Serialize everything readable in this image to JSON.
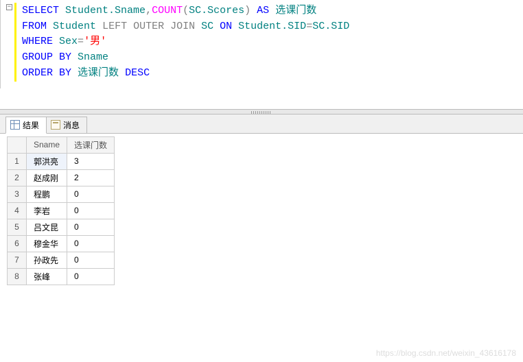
{
  "editor": {
    "collapse_symbol": "−",
    "line1": {
      "select": "SELECT",
      "col1": "Student.Sname",
      "comma": ",",
      "func": "COUNT",
      "paren_open": "(",
      "col2": "SC.Scores",
      "paren_close": ")",
      "as": "AS",
      "alias": "选课门数"
    },
    "line2": {
      "from": "FROM",
      "t1": "Student",
      "join": "LEFT OUTER JOIN",
      "t2": "SC",
      "on": "ON",
      "cond_l": "Student.SID",
      "eq": "=",
      "cond_r": "SC.SID"
    },
    "line3": {
      "where": "WHERE",
      "col": "Sex",
      "eq": "=",
      "q1": "'",
      "val": "男",
      "q2": "'"
    },
    "line4": {
      "group": "GROUP BY",
      "col": "Sname"
    },
    "line5": {
      "order": "ORDER BY",
      "col": "选课门数",
      "dir": "DESC"
    }
  },
  "tabs": {
    "results": "结果",
    "messages": "消息"
  },
  "grid": {
    "columns": [
      "Sname",
      "选课门数"
    ],
    "rows": [
      {
        "n": "1",
        "sname": "郭洪亮",
        "count": "3"
      },
      {
        "n": "2",
        "sname": "赵成刚",
        "count": "2"
      },
      {
        "n": "3",
        "sname": "程鹏",
        "count": "0"
      },
      {
        "n": "4",
        "sname": "李岩",
        "count": "0"
      },
      {
        "n": "5",
        "sname": "吕文昆",
        "count": "0"
      },
      {
        "n": "6",
        "sname": "穆金华",
        "count": "0"
      },
      {
        "n": "7",
        "sname": "孙政先",
        "count": "0"
      },
      {
        "n": "8",
        "sname": "张峰",
        "count": "0"
      }
    ]
  },
  "watermark": "https://blog.csdn.net/weixin_43616178"
}
